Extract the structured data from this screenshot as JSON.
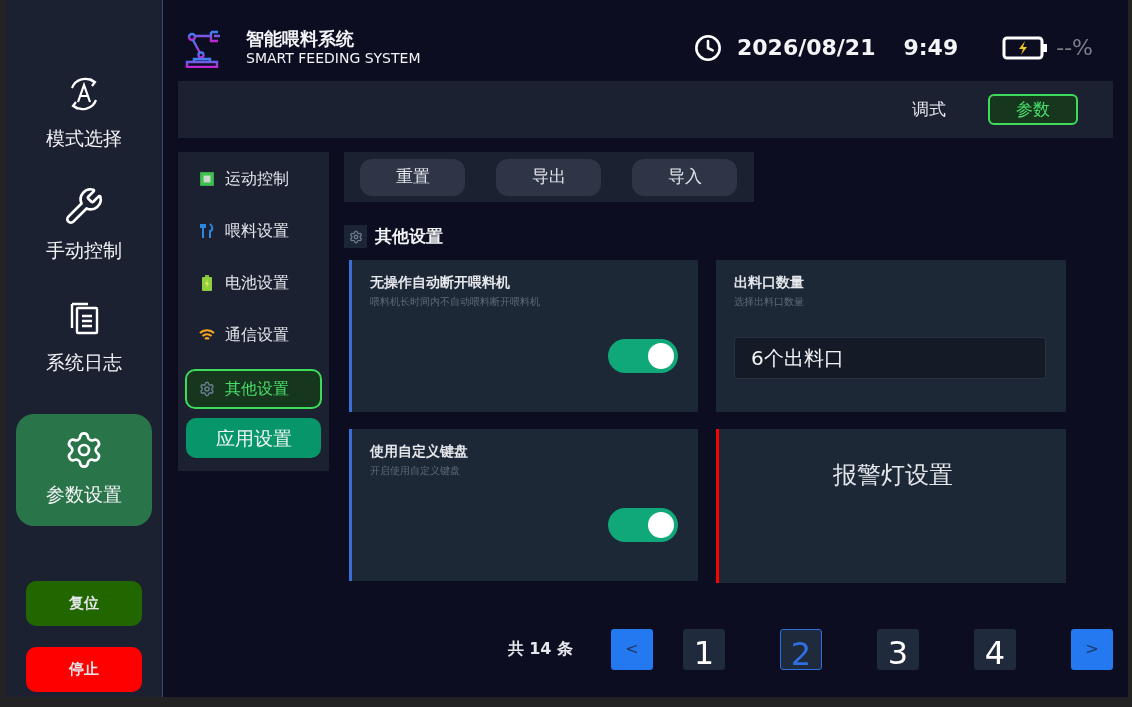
{
  "sidebar": {
    "items": [
      {
        "label": "模式选择",
        "selected": false
      },
      {
        "label": "手动控制",
        "selected": false
      },
      {
        "label": "系统日志",
        "selected": false
      },
      {
        "label": "参数设置",
        "selected": true
      }
    ],
    "actions": [
      {
        "label": "复位",
        "kind": "reset"
      },
      {
        "label": "停止",
        "kind": "stop"
      }
    ]
  },
  "header": {
    "title": "智能喂料系统",
    "subtitle": "SMART FEEDING SYSTEM",
    "date": "2026/08/21",
    "time": "9:49",
    "battery": "--%"
  },
  "tabs": [
    {
      "label": "调式",
      "selected": false
    },
    {
      "label": "参数",
      "selected": true
    }
  ],
  "settings_nav": {
    "items": [
      {
        "label": "运动控制",
        "selected": false
      },
      {
        "label": "喂料设置",
        "selected": false
      },
      {
        "label": "电池设置",
        "selected": false
      },
      {
        "label": "通信设置",
        "selected": false
      },
      {
        "label": "其他设置",
        "selected": true
      }
    ],
    "apply_button": "应用设置"
  },
  "toolbar": {
    "buttons": [
      "重置",
      "导出",
      "导入"
    ]
  },
  "section": {
    "title": "其他设置"
  },
  "cards": [
    {
      "kind": "toggle",
      "title": "无操作自动断开喂料机",
      "description": "喂料机长时间内不自动喂料断开喂料机",
      "on": true,
      "color": "#3b6fd8"
    },
    {
      "kind": "select",
      "title": "出料口数量",
      "description": "选择出料口数量",
      "value": "6个出料口"
    },
    {
      "kind": "toggle",
      "title": "使用自定义键盘",
      "description": "开启使用自定义键盘",
      "on": true,
      "color": "#3b6fd8"
    },
    {
      "kind": "link",
      "title": "报警灯设置",
      "color": "#ff0000"
    }
  ],
  "pagination": {
    "total": "共 14 条",
    "prev": "<",
    "next": ">",
    "pages": [
      {
        "label": "1",
        "selected": false
      },
      {
        "label": "2",
        "selected": true
      },
      {
        "label": "3",
        "selected": false
      },
      {
        "label": "4",
        "selected": false
      }
    ]
  }
}
